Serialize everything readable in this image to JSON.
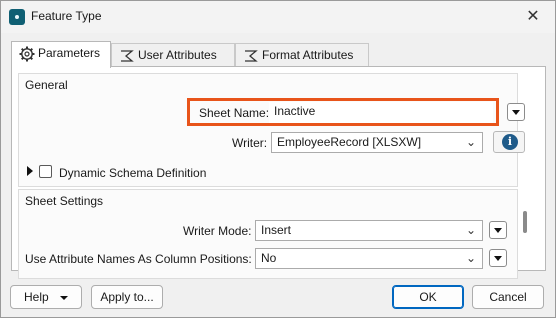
{
  "window": {
    "title": "Feature Type",
    "close_glyph": "✕"
  },
  "tabs": [
    {
      "label": "Parameters",
      "icon": "gear-icon",
      "active": true
    },
    {
      "label": "User Attributes",
      "icon": "sigma-icon",
      "active": false
    },
    {
      "label": "Format Attributes",
      "icon": "sigma-icon",
      "active": false
    }
  ],
  "general": {
    "group_label": "General",
    "sheet_name_label": "Sheet Name:",
    "sheet_name_value": "Inactive",
    "writer_label": "Writer:",
    "writer_value": "EmployeeRecord [XLSXW]",
    "dynamic_schema_label": "Dynamic Schema Definition",
    "dynamic_schema_checked": false,
    "highlight_color": "#e8541a"
  },
  "sheet_settings": {
    "group_label": "Sheet Settings",
    "writer_mode_label": "Writer Mode:",
    "writer_mode_value": "Insert",
    "use_attr_label": "Use Attribute Names As Column Positions:",
    "use_attr_value": "No"
  },
  "footer": {
    "help_label": "Help",
    "apply_label": "Apply to...",
    "ok_label": "OK",
    "cancel_label": "Cancel"
  }
}
